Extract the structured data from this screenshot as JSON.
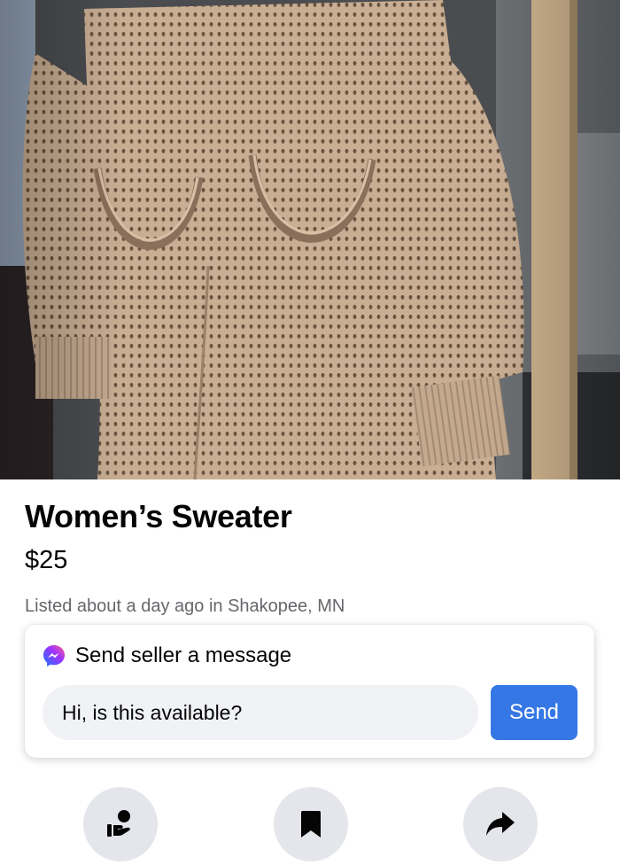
{
  "listing": {
    "title": "Women’s Sweater",
    "price": "$25",
    "meta": "Listed about a day ago in Shakopee, MN"
  },
  "message": {
    "header": "Send seller a message",
    "input_value": "Hi, is this available?",
    "send_label": "Send"
  },
  "actions": [
    {
      "icon": "seller-profile-icon"
    },
    {
      "icon": "bookmark-icon"
    },
    {
      "icon": "share-icon"
    }
  ],
  "colors": {
    "send_button": "#3578e5",
    "input_background": "#f0f2f5",
    "action_background": "#e4e6eb",
    "meta_text": "#65676b",
    "sweater": "#c8ad92"
  }
}
